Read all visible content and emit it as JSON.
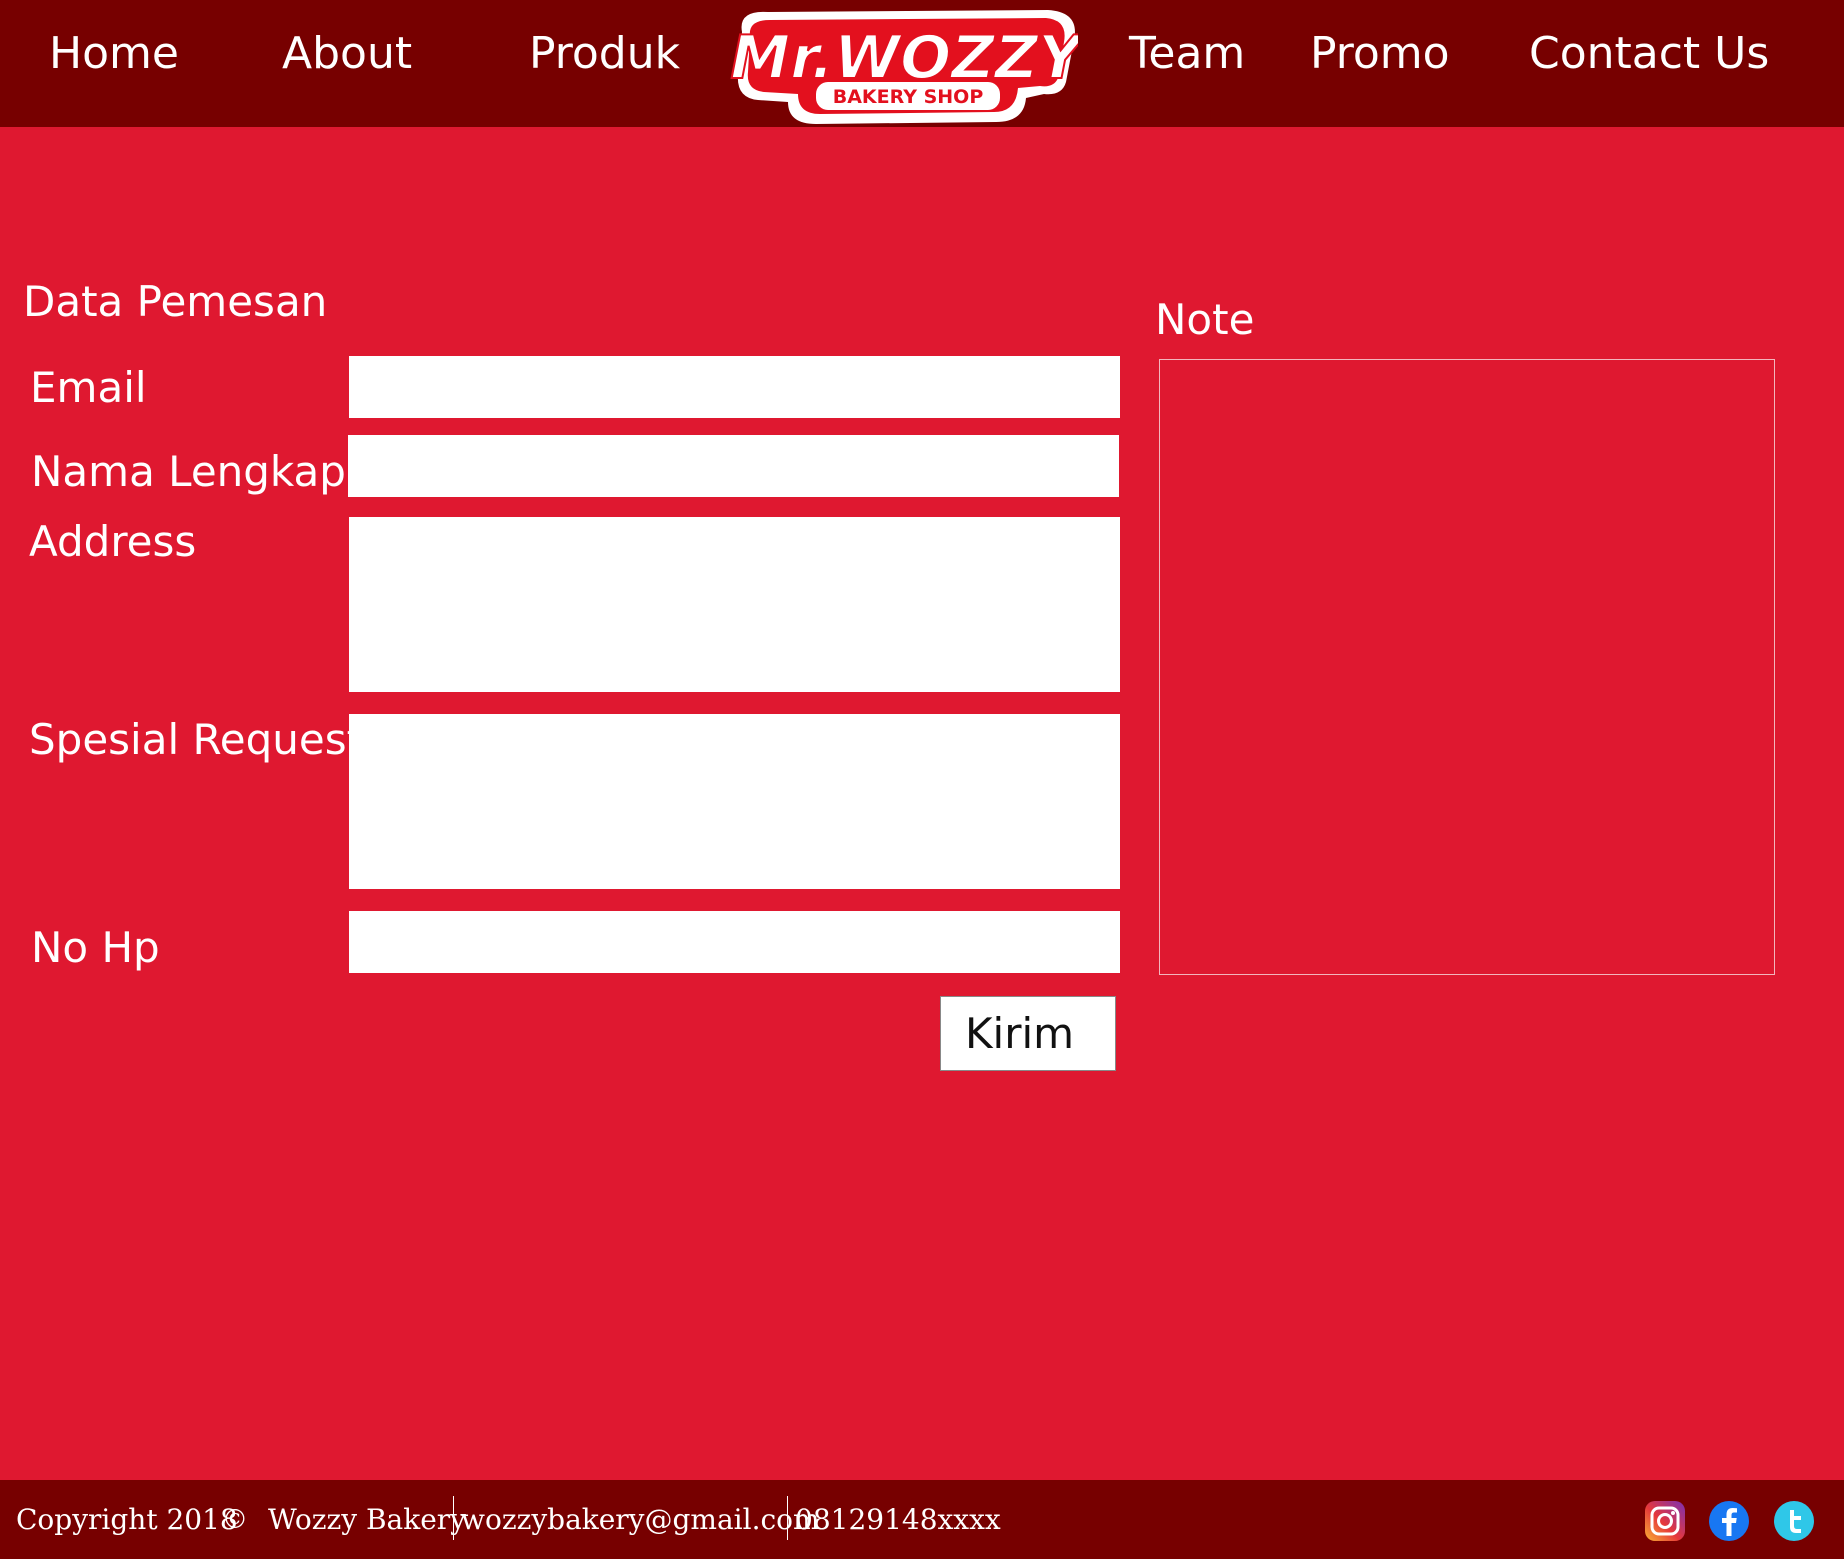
{
  "nav": {
    "items": [
      "Home",
      "About",
      "Produk",
      "Team",
      "Promo",
      "Contact Us"
    ]
  },
  "logo": {
    "title": "Mr.WOZZY",
    "subtitle": "BAKERY SHOP",
    "colors": {
      "primary": "#e3101e",
      "outline": "#ffffff"
    }
  },
  "form": {
    "section_title": "Data Pemesan",
    "email_label": "Email",
    "email_value": "",
    "fullname_label": "Nama Lengkap",
    "fullname_value": "",
    "address_label": "Address",
    "address_value": "",
    "special_label": "Spesial Request",
    "special_value": "",
    "phone_label": "No Hp",
    "phone_value": "",
    "submit_label": "Kirim"
  },
  "note": {
    "title": "Note",
    "value": ""
  },
  "footer": {
    "copyright": "Copyright 2018",
    "copyright_symbol": "©",
    "company": "Wozzy Bakery",
    "email": "wozzybakery@gmail.com",
    "phone": "08129148xxxx",
    "social": [
      "instagram-icon",
      "facebook-icon",
      "twitter-icon"
    ]
  },
  "colors": {
    "nav_bg": "#770000",
    "page_bg": "#df1830",
    "footer_bg": "#770000"
  }
}
